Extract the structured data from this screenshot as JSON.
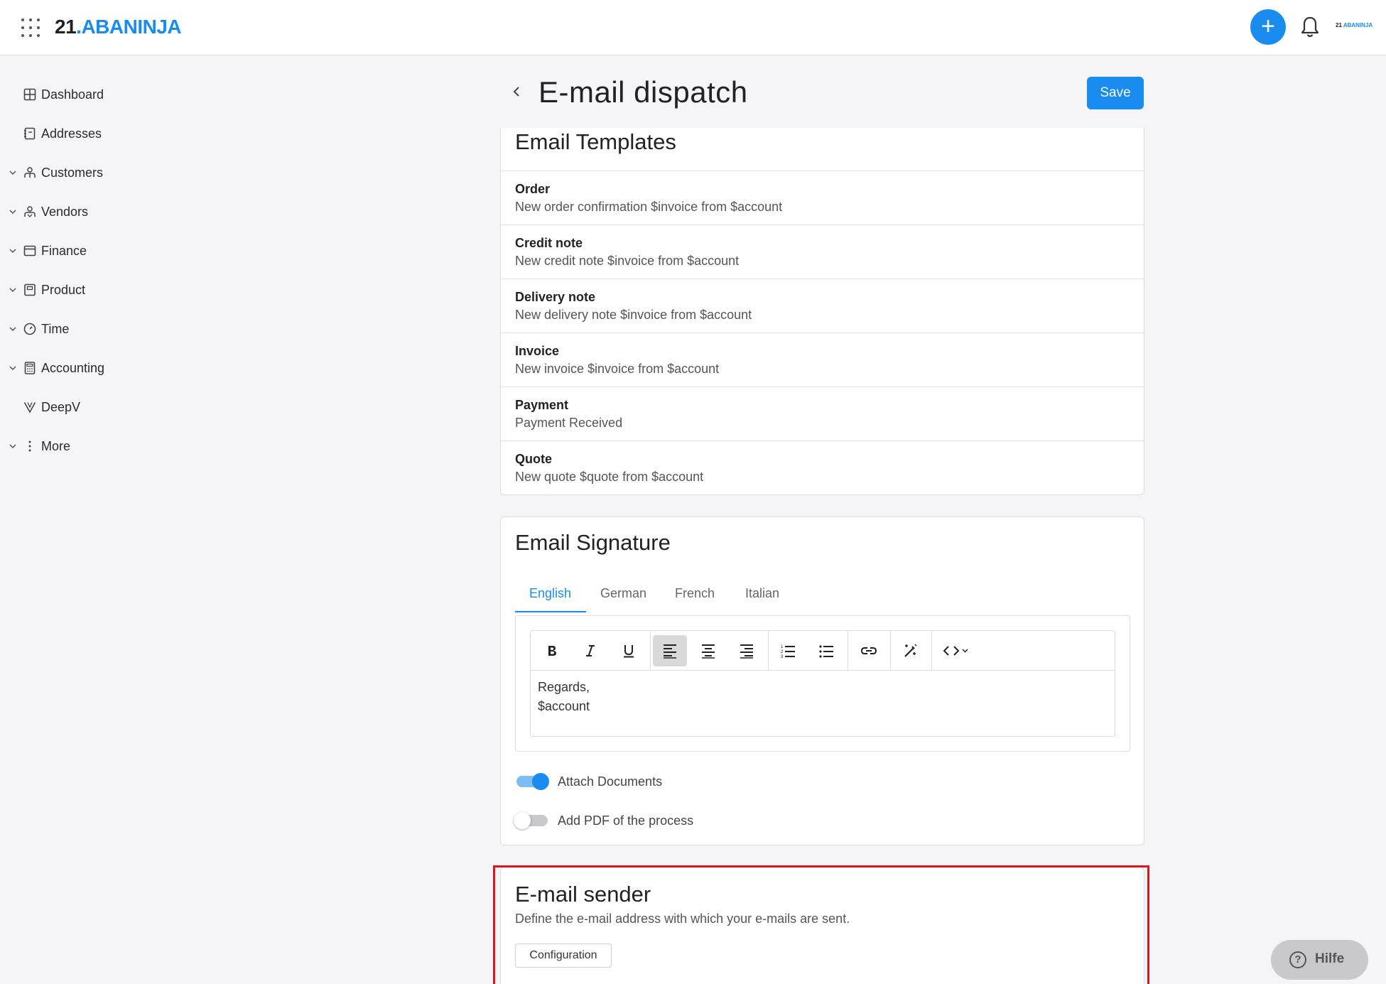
{
  "topbar": {
    "logo_num": "21",
    "logo_dot": ".",
    "logo_brand": "ABANINJA",
    "plus_label": "+",
    "mini_logo_num": "21",
    "mini_logo_brand": "ABANINJA",
    "colors": {
      "accent": "#1a8cf0"
    }
  },
  "sidebar": {
    "items": [
      {
        "label": "Dashboard",
        "icon": "dashboard-icon",
        "expandable": false
      },
      {
        "label": "Addresses",
        "icon": "address-book-icon",
        "expandable": false
      },
      {
        "label": "Customers",
        "icon": "customers-icon",
        "expandable": true
      },
      {
        "label": "Vendors",
        "icon": "vendors-icon",
        "expandable": true
      },
      {
        "label": "Finance",
        "icon": "finance-icon",
        "expandable": true
      },
      {
        "label": "Product",
        "icon": "product-icon",
        "expandable": true
      },
      {
        "label": "Time",
        "icon": "clock-icon",
        "expandable": true
      },
      {
        "label": "Accounting",
        "icon": "calculator-icon",
        "expandable": true
      },
      {
        "label": "DeepV",
        "icon": "deepv-icon",
        "expandable": false
      },
      {
        "label": "More",
        "icon": "more-vertical-icon",
        "expandable": true
      }
    ]
  },
  "header": {
    "title": "E-mail dispatch",
    "save_label": "Save"
  },
  "templates": {
    "title": "Email Templates",
    "rows": [
      {
        "title": "Order",
        "subject": "New order confirmation $invoice from $account"
      },
      {
        "title": "Credit note",
        "subject": "New credit note $invoice from $account"
      },
      {
        "title": "Delivery note",
        "subject": "New delivery note $invoice from $account"
      },
      {
        "title": "Invoice",
        "subject": "New invoice $invoice from $account"
      },
      {
        "title": "Payment",
        "subject": "Payment Received"
      },
      {
        "title": "Quote",
        "subject": "New quote $quote from $account"
      }
    ]
  },
  "signature": {
    "title": "Email Signature",
    "tabs": [
      "English",
      "German",
      "French",
      "Italian"
    ],
    "active_tab": "English",
    "body_lines": [
      "Regards,",
      "$account"
    ],
    "toolbar": [
      "bold-icon",
      "italic-icon",
      "underline-icon",
      "align-left-icon",
      "align-center-icon",
      "align-right-icon",
      "ordered-list-icon",
      "bullet-list-icon",
      "link-icon",
      "clear-format-icon",
      "code-icon"
    ],
    "toggles": [
      {
        "label": "Attach Documents",
        "on": true
      },
      {
        "label": "Add PDF of the process",
        "on": false
      }
    ]
  },
  "sender": {
    "title": "E-mail sender",
    "description": "Define the e-mail address with which your e-mails are sent.",
    "config_label": "Configuration"
  },
  "help": {
    "label": "Hilfe",
    "icon_glyph": "?"
  }
}
